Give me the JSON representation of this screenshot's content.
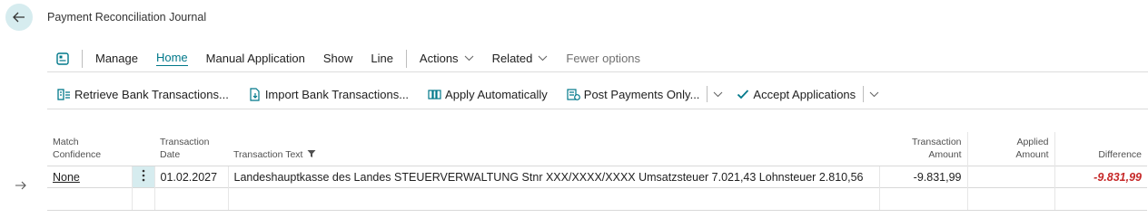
{
  "page": {
    "title": "Payment Reconciliation Journal"
  },
  "actionbar": {
    "items": [
      {
        "label": "Manage"
      },
      {
        "label": "Home"
      },
      {
        "label": "Manual Application"
      },
      {
        "label": "Show"
      },
      {
        "label": "Line"
      }
    ],
    "actions_label": "Actions",
    "related_label": "Related",
    "fewer_label": "Fewer options"
  },
  "promoted": [
    {
      "label": "Retrieve Bank Transactions..."
    },
    {
      "label": "Import Bank Transactions..."
    },
    {
      "label": "Apply Automatically"
    },
    {
      "label": "Post Payments Only..."
    },
    {
      "label": "Accept Applications"
    }
  ],
  "columns": {
    "match_confidence": [
      "Match",
      "Confidence"
    ],
    "transaction_date": [
      "Transaction",
      "Date"
    ],
    "transaction_text": "Transaction Text",
    "transaction_amount": [
      "Transaction",
      "Amount"
    ],
    "applied_amount": [
      "Applied",
      "Amount"
    ],
    "difference": "Difference"
  },
  "rows": [
    {
      "match_confidence": "None",
      "transaction_date": "01.02.2027",
      "transaction_text": "Landeshauptkasse des Landes STEUERVERWALTUNG Stnr XXX/XXXX/XXXX Umsatzsteuer 7.021,43 Lohnsteuer 2.810,56",
      "transaction_amount": "-9.831,99",
      "applied_amount": "",
      "difference": "-9.831,99"
    }
  ],
  "colors": {
    "accent": "#00788a",
    "negative": "#c62828",
    "selected_bg": "#d6ecef"
  }
}
